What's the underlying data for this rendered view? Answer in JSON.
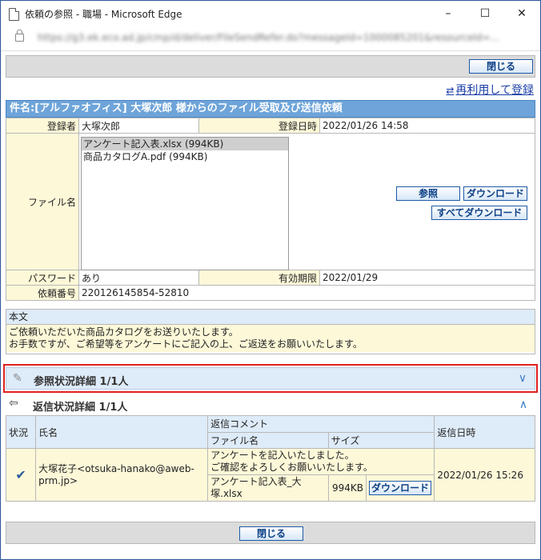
{
  "window": {
    "title": "依頼の参照 - 職場 - Microsoft Edge",
    "url": "https://g3.ek.eco.ad.jp/cmp/d/deliver/FileSendRefer.do?messageId=1000085201&resourceId=..."
  },
  "toolbar": {
    "close_label": "閉じる"
  },
  "reuse_link": "再利用して登録",
  "subject": "件名:[アルファオフィス] 大塚次郎 様からのファイル受取及び送信依頼",
  "info": {
    "registrant_label": "登録者",
    "registrant_value": "大塚次郎",
    "date_label": "登録日時",
    "date_value": "2022/01/26 14:58",
    "file_label": "ファイル名",
    "files": [
      "アンケート記入表.xlsx (994KB)",
      "商品カタログA.pdf (994KB)"
    ],
    "view_button": "参照",
    "download_button": "ダウンロード",
    "download_all_button": "すべてダウンロード",
    "password_label": "パスワード",
    "password_value": "あり",
    "expire_label": "有効期限",
    "expire_value": "2022/01/29",
    "request_label": "依頼番号",
    "request_value": "220126145854-52810"
  },
  "body": {
    "label": "本文",
    "line1": "ご依頼いただいた商品カタログをお送りいたします。",
    "line2": "お手数ですが、ご希望等をアンケートにご記入の上、ご返送をお願いいたします。"
  },
  "ref_section": {
    "title": "参照状況詳細 1/1人"
  },
  "reply_section": {
    "title": "返信状況詳細 1/1人",
    "col_status": "状況",
    "col_name": "氏名",
    "col_comment": "返信コメント",
    "col_file": "ファイル名",
    "col_size": "サイズ",
    "col_date": "返信日時",
    "row": {
      "name": "大塚花子<otsuka-hanako@aweb-prm.jp>",
      "comment1": "アンケートを記入いたしました。",
      "comment2": "ご確認をよろしくお願いいたします。",
      "file": "アンケート記入表_大塚.xlsx",
      "size": "994KB",
      "download": "ダウンロード",
      "date": "2022/01/26 15:26"
    }
  },
  "colors": {
    "header_blue": "#6ea4d9",
    "label_yellow": "#fdf8d8",
    "section_blue": "#deebf8",
    "highlight_red": "#e0201f"
  }
}
